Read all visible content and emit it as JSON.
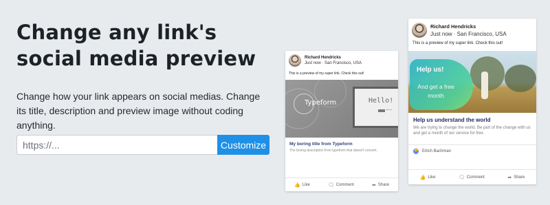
{
  "hero": {
    "title": "Change any link's social media preview",
    "subtitle": "Change how your link appears on social medias. Change its title, description and preview image without coding anything."
  },
  "form": {
    "url_placeholder": "https://...",
    "customize_label": "Customize"
  },
  "card_left": {
    "author": "Richard Hendricks",
    "meta": "Just now · San Francisco, USA",
    "post_text": "This is a preview of my super link. Check this out!",
    "image_logo": "Typeform",
    "image_hello": "Hello!",
    "link_title": "My boring title from Typeform",
    "link_description": "The boring description from typeform that doesn't convert.",
    "actions": [
      "Like",
      "Comment",
      "Share"
    ]
  },
  "card_right": {
    "author": "Richard Hendricks",
    "meta": "Just now · San Francisco, USA",
    "post_text": "This is a preview of my super link. Check this out!",
    "image_headline": "Help us!",
    "image_subline": "And get a free month",
    "link_title": "Help us understand the world",
    "link_description": "We are trying to change the world. Be part of the change with us and get a month of our service for free.",
    "liker": "Erlich Bachman",
    "actions": [
      "Like",
      "Comment",
      "Share"
    ]
  }
}
